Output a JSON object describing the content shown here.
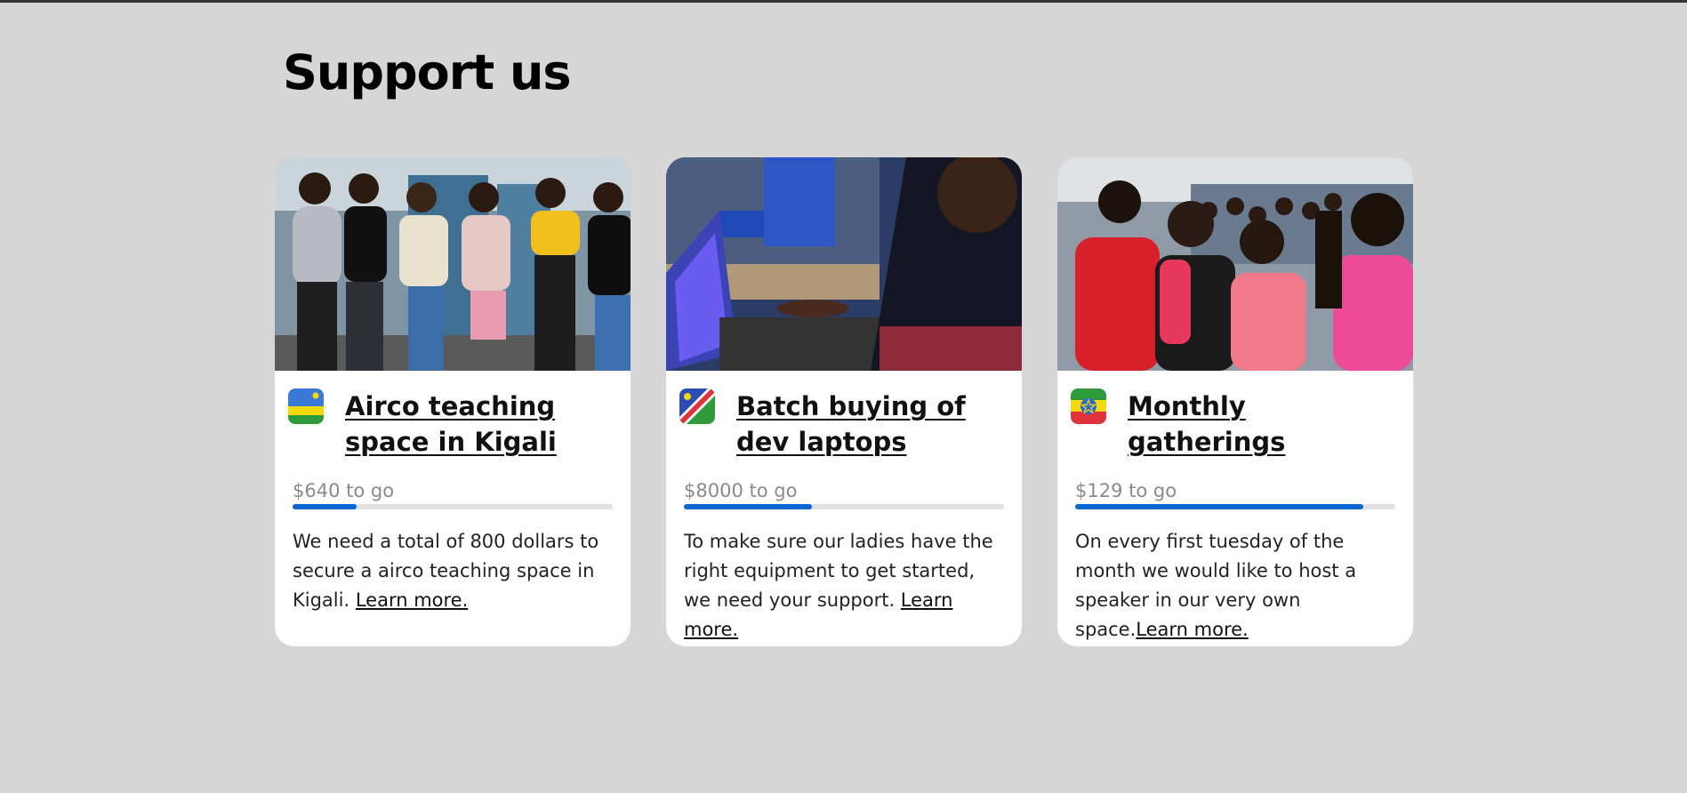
{
  "page": {
    "heading": "Support us"
  },
  "colors": {
    "background": "#d6d6d6",
    "progress_fill": "#0a66d0",
    "progress_track": "#e0e0e0"
  },
  "cards": [
    {
      "flag_icon": "rwanda-flag-icon",
      "title": "Airco teaching space in Kigali",
      "to_go": "$640 to go",
      "progress_fraction": 0.2,
      "description": "We need a total of 800 dollars to secure a airco teaching space in Kigali. ",
      "learn_more": "Learn more."
    },
    {
      "flag_icon": "namibia-flag-icon",
      "title": "Batch buying of dev laptops",
      "to_go": "$8000 to go",
      "progress_fraction": 0.4,
      "description": "To make sure our ladies have the right equipment to get started, we need your support. ",
      "learn_more": "Learn more."
    },
    {
      "flag_icon": "ethiopia-flag-icon",
      "title": "Monthly gatherings",
      "to_go": "$129 to go",
      "progress_fraction": 0.9,
      "description": "On every first tuesday of the month we would like to host a speaker in our very own space.",
      "learn_more": "Learn more."
    }
  ]
}
